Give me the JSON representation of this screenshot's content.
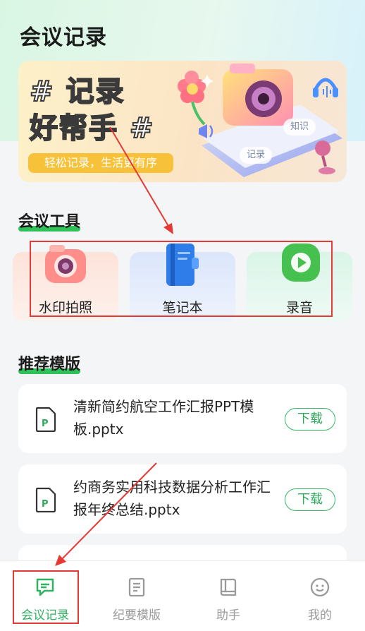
{
  "header": {
    "title": "会议记录"
  },
  "banner": {
    "headline_line1": "# 记录",
    "headline_line2": "好帮手 #",
    "slogan": "轻松记录，生活更有序",
    "chips": [
      "知识",
      "记录"
    ]
  },
  "tools_section": {
    "title": "会议工具",
    "items": [
      {
        "label": "水印拍照",
        "icon": "camera-icon",
        "bg": "#fde4dc"
      },
      {
        "label": "笔记本",
        "icon": "notebook-icon",
        "bg": "#dde8fb"
      },
      {
        "label": "录音",
        "icon": "play-icon",
        "bg": "#ddf6ea"
      }
    ]
  },
  "templates_section": {
    "title": "推荐模版",
    "items": [
      {
        "title": "清新简约航空工作汇报PPT模板.pptx",
        "action": "下载",
        "icon": "ppt-file-icon"
      },
      {
        "title": "约商务实用科技数据分析工作汇报年终总结.pptx",
        "action": "下载",
        "icon": "ppt-file-icon"
      }
    ]
  },
  "bottom_nav": {
    "items": [
      {
        "label": "会议记录",
        "icon": "chat-icon",
        "active": true
      },
      {
        "label": "纪要模版",
        "icon": "document-icon",
        "active": false
      },
      {
        "label": "助手",
        "icon": "book-icon",
        "active": false
      },
      {
        "label": "我的",
        "icon": "smile-icon",
        "active": false
      }
    ]
  },
  "colors": {
    "accent": "#2fb062",
    "annotation": "#e53935",
    "banner_slogan": "#f7c23a"
  }
}
